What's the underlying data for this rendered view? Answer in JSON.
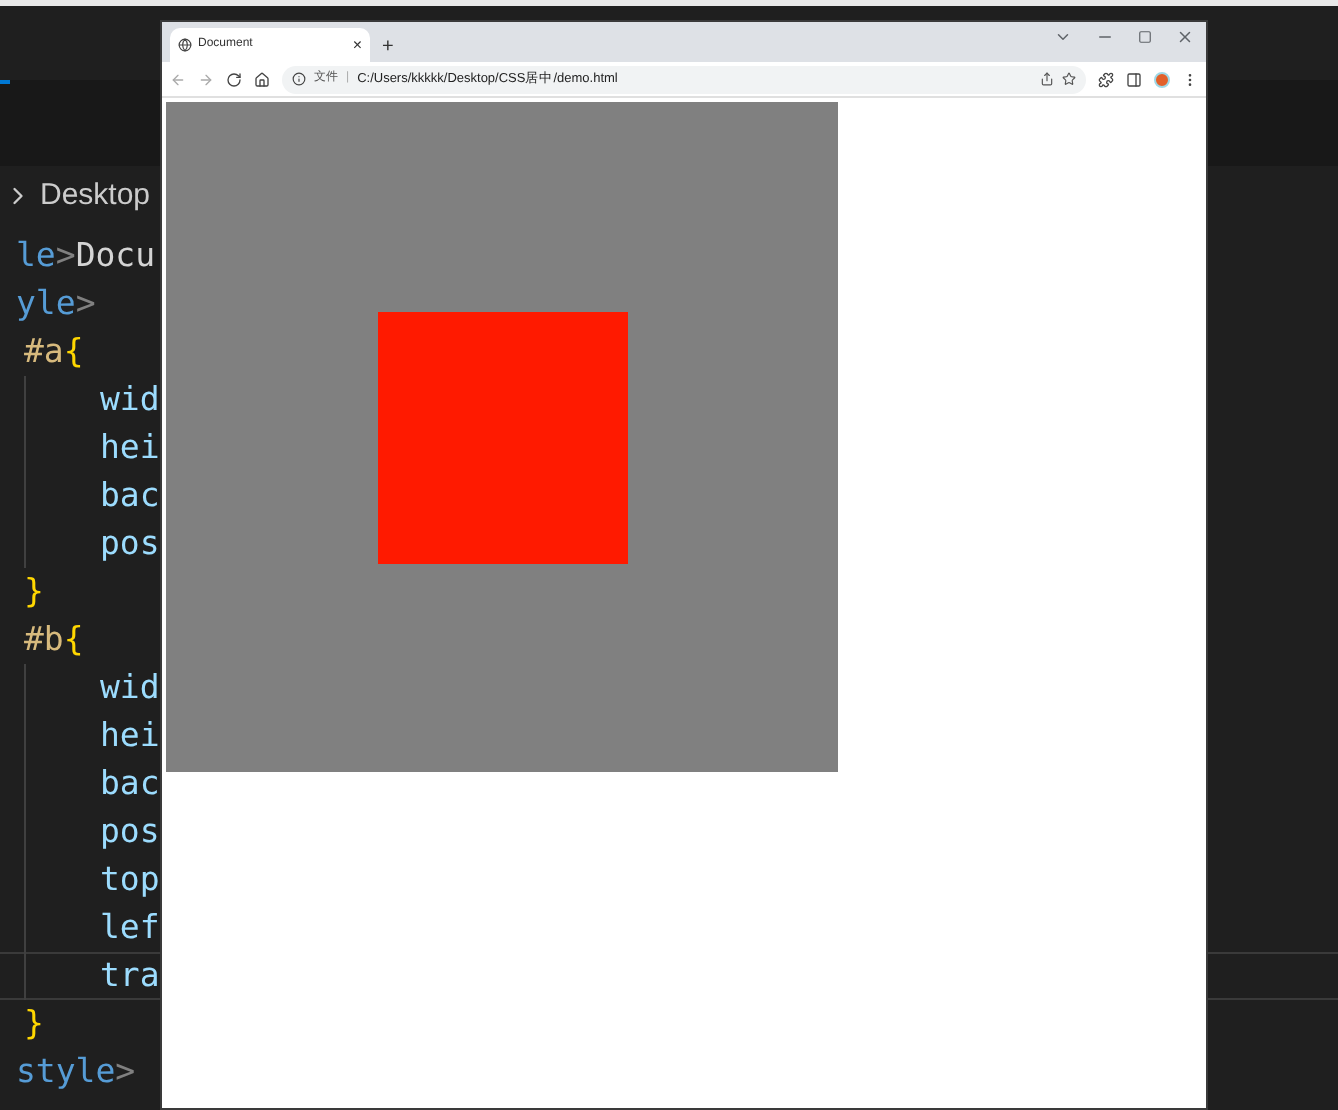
{
  "editor": {
    "breadcrumb": {
      "parts": [
        "Desktop"
      ]
    },
    "lines": [
      {
        "kind": "tag",
        "segments": [
          {
            "text": "le",
            "kind": "tag"
          },
          {
            "text": ">",
            "kind": "bracket"
          },
          {
            "text": "Docu",
            "kind": "text"
          }
        ]
      },
      {
        "kind": "tag",
        "segments": [
          {
            "text": "yle",
            "kind": "tag"
          },
          {
            "text": ">",
            "kind": "bracket"
          }
        ]
      },
      {
        "kind": "rule",
        "selector": "#a",
        "open": "{",
        "properties": [
          {
            "text": "wid",
            "current": false
          },
          {
            "text": "hei",
            "current": false
          },
          {
            "text": "bac",
            "current": false
          },
          {
            "text": "pos",
            "current": false
          }
        ],
        "close": "}"
      },
      {
        "kind": "rule",
        "selector": "#b",
        "open": "{",
        "properties": [
          {
            "text": "wid",
            "current": false
          },
          {
            "text": "hei",
            "current": false
          },
          {
            "text": "bac",
            "current": false
          },
          {
            "text": "pos",
            "current": false
          },
          {
            "text": "top",
            "current": false
          },
          {
            "text": "lef",
            "current": false
          },
          {
            "text": "tra",
            "current": true
          }
        ],
        "close": "}"
      },
      {
        "kind": "tag",
        "segments": [
          {
            "text": "style",
            "kind": "tag"
          },
          {
            "text": ">",
            "kind": "bracket"
          }
        ]
      }
    ]
  },
  "browser": {
    "tabs": [
      {
        "title": "Document",
        "close": "×",
        "selected": true
      }
    ],
    "new_tab": "+",
    "address": {
      "scheme_label": "文件",
      "separator": "|",
      "url": "C:/Users/kkkkk/Desktop/CSS居中/demo.html"
    },
    "page": {
      "outer_box": {
        "color": "#808080"
      },
      "inner_box": {
        "color": "#ff1a00"
      }
    }
  }
}
